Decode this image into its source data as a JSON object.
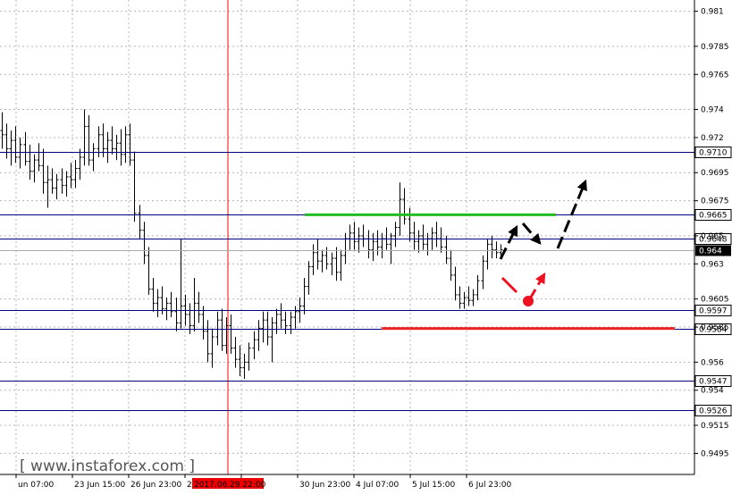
{
  "chart_data": {
    "type": "candlestick",
    "title": "",
    "xlabel": "",
    "ylabel": "",
    "ylim": [
      0.948,
      0.9818
    ],
    "grid": true,
    "y_ticks": [
      0.981,
      0.9785,
      0.9765,
      0.974,
      0.972,
      0.9695,
      0.9675,
      0.965,
      0.963,
      0.9605,
      0.9585,
      0.956,
      0.954,
      0.9515,
      0.9495
    ],
    "x_ticks": [
      "un 07:00",
      "23 Jun 15:00",
      "26 Jun 23:00",
      "28 Jun 07:00",
      "2017.06.29 22:00",
      "30 Jun 23:00",
      "4 Jul 07:00",
      "5 Jul 15:00",
      "6 Jul 23:00"
    ],
    "highlighted_x_tick": "2017.06.29 22:00",
    "current_price": 0.964,
    "levels": [
      {
        "value": 0.971,
        "label": "0.9710"
      },
      {
        "value": 0.9665,
        "label": "0.9665"
      },
      {
        "value": 0.9648,
        "label": "0.9648"
      },
      {
        "value": 0.9597,
        "label": "0.9597"
      },
      {
        "value": 0.9584,
        "label": "0.9584"
      },
      {
        "value": 0.9547,
        "label": "0.9547"
      },
      {
        "value": 0.9526,
        "label": "0.9526"
      }
    ],
    "resistance": {
      "value": 0.9665,
      "color": "#22bb22"
    },
    "support": {
      "value": 0.9584,
      "color": "#ee2222"
    },
    "price_path": [
      [
        0.9725,
        0.9738,
        0.9712,
        0.9722
      ],
      [
        0.9722,
        0.973,
        0.9705,
        0.9712
      ],
      [
        0.9712,
        0.9725,
        0.97,
        0.9718
      ],
      [
        0.9718,
        0.9728,
        0.9702,
        0.9706
      ],
      [
        0.9706,
        0.972,
        0.9698,
        0.9715
      ],
      [
        0.9715,
        0.9724,
        0.97,
        0.9703
      ],
      [
        0.9703,
        0.9715,
        0.969,
        0.9696
      ],
      [
        0.9696,
        0.9708,
        0.9688,
        0.9704
      ],
      [
        0.9704,
        0.9716,
        0.9696,
        0.97
      ],
      [
        0.97,
        0.9712,
        0.968,
        0.9688
      ],
      [
        0.9688,
        0.97,
        0.967,
        0.969
      ],
      [
        0.969,
        0.9698,
        0.968,
        0.9684
      ],
      [
        0.9684,
        0.9694,
        0.9676,
        0.969
      ],
      [
        0.969,
        0.9698,
        0.968,
        0.9686
      ],
      [
        0.9686,
        0.9696,
        0.9678,
        0.9692
      ],
      [
        0.9692,
        0.9702,
        0.9684,
        0.969
      ],
      [
        0.969,
        0.9704,
        0.9684,
        0.9698
      ],
      [
        0.9698,
        0.9712,
        0.969,
        0.9706
      ],
      [
        0.9706,
        0.974,
        0.97,
        0.9728
      ],
      [
        0.9728,
        0.9736,
        0.97,
        0.9704
      ],
      [
        0.9704,
        0.9716,
        0.9696,
        0.9712
      ],
      [
        0.9712,
        0.9728,
        0.9706,
        0.9722
      ],
      [
        0.9722,
        0.973,
        0.9706,
        0.9712
      ],
      [
        0.9712,
        0.9724,
        0.9702,
        0.9718
      ],
      [
        0.9718,
        0.9728,
        0.9708,
        0.9712
      ],
      [
        0.9712,
        0.9722,
        0.9704,
        0.9716
      ],
      [
        0.9716,
        0.9726,
        0.97,
        0.9708
      ],
      [
        0.9708,
        0.9728,
        0.9702,
        0.9722
      ],
      [
        0.9722,
        0.973,
        0.97,
        0.9704
      ],
      [
        0.9704,
        0.971,
        0.966,
        0.9666
      ],
      [
        0.9666,
        0.9672,
        0.9648,
        0.9654
      ],
      [
        0.9654,
        0.966,
        0.963,
        0.9636
      ],
      [
        0.9636,
        0.9642,
        0.9608,
        0.9612
      ],
      [
        0.9612,
        0.962,
        0.9596,
        0.9602
      ],
      [
        0.9602,
        0.9612,
        0.9592,
        0.9606
      ],
      [
        0.9606,
        0.9614,
        0.9594,
        0.9598
      ],
      [
        0.9598,
        0.9606,
        0.959,
        0.9602
      ],
      [
        0.9602,
        0.961,
        0.9592,
        0.9596
      ],
      [
        0.9596,
        0.9606,
        0.9582,
        0.9588
      ],
      [
        0.9588,
        0.9648,
        0.9584,
        0.96
      ],
      [
        0.96,
        0.9608,
        0.9586,
        0.9594
      ],
      [
        0.9594,
        0.9602,
        0.958,
        0.9586
      ],
      [
        0.9586,
        0.962,
        0.9582,
        0.9602
      ],
      [
        0.9602,
        0.961,
        0.9588,
        0.9594
      ],
      [
        0.9594,
        0.96,
        0.9576,
        0.9582
      ],
      [
        0.9582,
        0.959,
        0.956,
        0.9566
      ],
      [
        0.9566,
        0.9584,
        0.9556,
        0.9578
      ],
      [
        0.9578,
        0.9596,
        0.9572,
        0.959
      ],
      [
        0.959,
        0.9598,
        0.9568,
        0.9572
      ],
      [
        0.9572,
        0.9592,
        0.9566,
        0.9586
      ],
      [
        0.9586,
        0.9594,
        0.9566,
        0.957
      ],
      [
        0.957,
        0.9578,
        0.9556,
        0.9562
      ],
      [
        0.9562,
        0.9572,
        0.955,
        0.9556
      ],
      [
        0.9556,
        0.9566,
        0.9548,
        0.956
      ],
      [
        0.956,
        0.9574,
        0.9554,
        0.957
      ],
      [
        0.957,
        0.9582,
        0.9562,
        0.9576
      ],
      [
        0.9576,
        0.959,
        0.9568,
        0.9584
      ],
      [
        0.9584,
        0.9596,
        0.9574,
        0.959
      ],
      [
        0.959,
        0.9596,
        0.9572,
        0.9578
      ],
      [
        0.9578,
        0.9592,
        0.956,
        0.9588
      ],
      [
        0.9588,
        0.9598,
        0.958,
        0.9594
      ],
      [
        0.9594,
        0.9602,
        0.9584,
        0.959
      ],
      [
        0.959,
        0.9596,
        0.958,
        0.9586
      ],
      [
        0.9586,
        0.9596,
        0.958,
        0.9592
      ],
      [
        0.9592,
        0.96,
        0.9584,
        0.9596
      ],
      [
        0.9596,
        0.9606,
        0.9588,
        0.96
      ],
      [
        0.96,
        0.962,
        0.9594,
        0.9614
      ],
      [
        0.9614,
        0.9632,
        0.9608,
        0.9628
      ],
      [
        0.9628,
        0.9644,
        0.9622,
        0.9638
      ],
      [
        0.9638,
        0.9648,
        0.9626,
        0.9632
      ],
      [
        0.9632,
        0.964,
        0.9624,
        0.9636
      ],
      [
        0.9636,
        0.9642,
        0.9626,
        0.963
      ],
      [
        0.963,
        0.9638,
        0.9622,
        0.9634
      ],
      [
        0.9634,
        0.9642,
        0.9618,
        0.9624
      ],
      [
        0.9624,
        0.964,
        0.9618,
        0.9636
      ],
      [
        0.9636,
        0.9652,
        0.963,
        0.9648
      ],
      [
        0.9648,
        0.9658,
        0.964,
        0.9652
      ],
      [
        0.9652,
        0.966,
        0.964,
        0.9646
      ],
      [
        0.9646,
        0.9656,
        0.9638,
        0.965
      ],
      [
        0.965,
        0.9658,
        0.9642,
        0.9648
      ],
      [
        0.9648,
        0.9654,
        0.9634,
        0.964
      ],
      [
        0.964,
        0.9652,
        0.9632,
        0.9646
      ],
      [
        0.9646,
        0.9654,
        0.9636,
        0.9642
      ],
      [
        0.9642,
        0.9652,
        0.9634,
        0.9648
      ],
      [
        0.9648,
        0.9656,
        0.964,
        0.9644
      ],
      [
        0.9644,
        0.9652,
        0.963,
        0.965
      ],
      [
        0.965,
        0.966,
        0.9642,
        0.9656
      ],
      [
        0.9656,
        0.9688,
        0.965,
        0.9676
      ],
      [
        0.9676,
        0.9684,
        0.9658,
        0.9662
      ],
      [
        0.9662,
        0.967,
        0.9646,
        0.9652
      ],
      [
        0.9652,
        0.966,
        0.964,
        0.9646
      ],
      [
        0.9646,
        0.9654,
        0.9638,
        0.965
      ],
      [
        0.965,
        0.9658,
        0.964,
        0.9644
      ],
      [
        0.9644,
        0.9652,
        0.9636,
        0.9648
      ],
      [
        0.9648,
        0.9656,
        0.964,
        0.9652
      ],
      [
        0.9652,
        0.966,
        0.9642,
        0.9648
      ],
      [
        0.9648,
        0.9656,
        0.9638,
        0.9642
      ],
      [
        0.9642,
        0.965,
        0.963,
        0.9634
      ],
      [
        0.9634,
        0.964,
        0.9618,
        0.9622
      ],
      [
        0.9622,
        0.9628,
        0.9604,
        0.9608
      ],
      [
        0.9608,
        0.9614,
        0.9598,
        0.9602
      ],
      [
        0.9602,
        0.961,
        0.9598,
        0.9606
      ],
      [
        0.9606,
        0.9614,
        0.96,
        0.9604
      ],
      [
        0.9604,
        0.9612,
        0.96,
        0.9608
      ],
      [
        0.9608,
        0.9622,
        0.9604,
        0.9618
      ],
      [
        0.9618,
        0.9636,
        0.9612,
        0.9632
      ],
      [
        0.9632,
        0.9648,
        0.9626,
        0.9644
      ],
      [
        0.9644,
        0.965,
        0.9634,
        0.964
      ],
      [
        0.964,
        0.9646,
        0.9634,
        0.9638
      ],
      [
        0.9638,
        0.9644,
        0.9634,
        0.964
      ]
    ]
  },
  "watermark": {
    "text": "[ www.instaforex.com ]"
  },
  "colors": {
    "level_line": "#000080",
    "candle": "#000000",
    "vertical_marker": "#ff0000",
    "highlight_tick_bg": "#ee0000",
    "arrow_black": "#000000",
    "arrow_red": "#ee1122",
    "watermark": "#555555"
  }
}
